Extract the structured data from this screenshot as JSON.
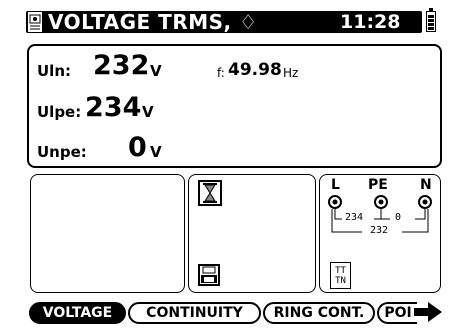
{
  "header": {
    "title": "VOLTAGE TRMS, ♢",
    "time": "11:28",
    "icon": "instrument-icon",
    "battery": "battery-icon"
  },
  "measurements": {
    "uln_label": "Uln:",
    "uln_value": "232",
    "uln_unit": "V",
    "ulpe_label": "Ulpe:",
    "ulpe_value": "234",
    "ulpe_unit": "V",
    "unpe_label": "Unpe:",
    "unpe_value": "0",
    "unpe_unit": "V",
    "freq_label": "f:",
    "freq_value": "49.98",
    "freq_unit": "Hz"
  },
  "diagram": {
    "l": "L",
    "pe": "PE",
    "n": "N",
    "lpe": "234",
    "pen": "0",
    "ln": "232",
    "system": [
      "TT",
      "TN"
    ]
  },
  "icons": {
    "hourglass": "hourglass-icon",
    "save": "save-icon",
    "more": "arrow-right-icon"
  },
  "tabs": [
    {
      "label": "VOLTAGE",
      "active": true
    },
    {
      "label": "CONTINUITY",
      "active": false
    },
    {
      "label": "RING CONT.",
      "active": false
    },
    {
      "label": "POI",
      "active": false
    }
  ]
}
